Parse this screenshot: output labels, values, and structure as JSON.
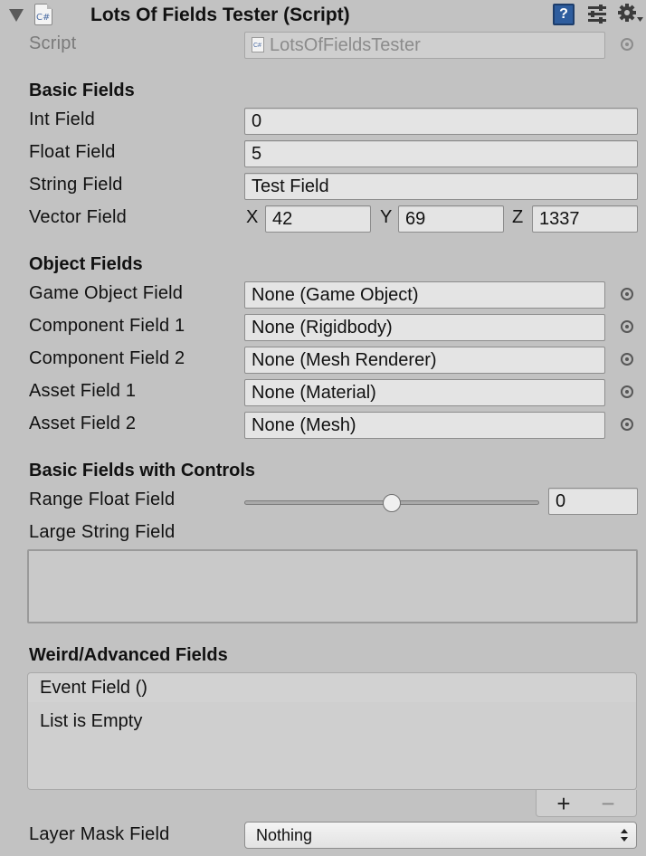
{
  "component": {
    "title": "Lots Of Fields Tester (Script)",
    "script_icon_text": "C#",
    "help_icon_text": "?"
  },
  "script_row": {
    "label": "Script",
    "value": "LotsOfFieldsTester"
  },
  "sections": {
    "basic": "Basic Fields",
    "object": "Object Fields",
    "controls": "Basic Fields with Controls",
    "advanced": "Weird/Advanced Fields"
  },
  "basic_fields": {
    "int_label": "Int Field",
    "int_value": "0",
    "float_label": "Float Field",
    "float_value": "5",
    "string_label": "String Field",
    "string_value": "Test Field",
    "vector_label": "Vector Field",
    "vector_x_label": "X",
    "vector_x": "42",
    "vector_y_label": "Y",
    "vector_y": "69",
    "vector_z_label": "Z",
    "vector_z": "1337"
  },
  "object_fields": [
    {
      "label": "Game Object Field",
      "value": "None (Game Object)"
    },
    {
      "label": "Component Field 1",
      "value": "None (Rigidbody)"
    },
    {
      "label": "Component Field 2",
      "value": "None (Mesh Renderer)"
    },
    {
      "label": "Asset Field 1",
      "value": "None (Material)"
    },
    {
      "label": "Asset Field 2",
      "value": "None (Mesh)"
    }
  ],
  "controls": {
    "range_label": "Range Float Field",
    "range_value": "0",
    "range_thumb_fraction": 0.5,
    "large_string_label": "Large String Field",
    "large_string_value": ""
  },
  "advanced": {
    "event_header": "Event Field ()",
    "event_empty": "List is Empty",
    "add_button": "+",
    "remove_button": "−",
    "layer_mask_label": "Layer Mask Field",
    "layer_mask_value": "Nothing"
  },
  "colors": {
    "background": "#c2c2c2",
    "field": "#e4e4e4",
    "help_icon": "#2e5d9e"
  }
}
